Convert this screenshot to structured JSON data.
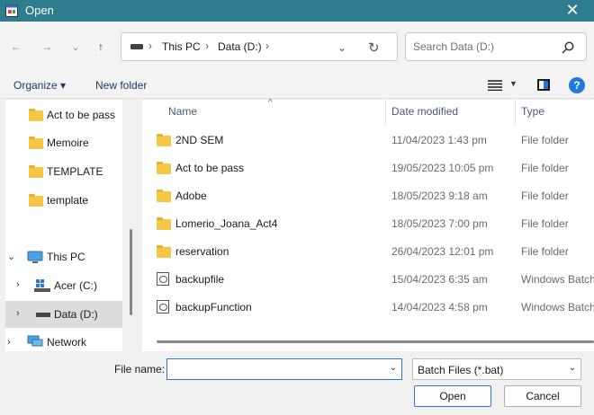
{
  "window": {
    "title": "Open",
    "close_glyph": "✕"
  },
  "nav": {
    "back_glyph": "←",
    "forward_glyph": "→",
    "recent_glyph": "⌄",
    "up_glyph": "↑",
    "breadcrumbs": [
      "This PC",
      "Data (D:)"
    ],
    "crumb_sep": "›",
    "dropdown_glyph": "⌄",
    "refresh_glyph": "↻",
    "search_placeholder": "Search Data (D:)"
  },
  "commands": {
    "organize": "Organize ▾",
    "new_folder": "New folder",
    "help": "?"
  },
  "sidebar": {
    "items": [
      {
        "label": "Act to be pass",
        "icon": "folder-icon",
        "expander": ""
      },
      {
        "label": "Memoire",
        "icon": "folder-icon",
        "expander": ""
      },
      {
        "label": "TEMPLATE",
        "icon": "folder-icon",
        "expander": ""
      },
      {
        "label": "template",
        "icon": "folder-icon",
        "expander": ""
      },
      {
        "label": "This PC",
        "icon": "computer-icon",
        "expander": "⌄"
      },
      {
        "label": "Acer (C:)",
        "icon": "drive-icon",
        "expander": "›"
      },
      {
        "label": "Data (D:)",
        "icon": "drive-icon",
        "expander": "›",
        "selected": true
      },
      {
        "label": "Network",
        "icon": "network-icon",
        "expander": "›"
      }
    ]
  },
  "filelist": {
    "columns": {
      "name": "Name",
      "date": "Date modified",
      "type": "Type"
    },
    "sort_glyph": "^",
    "rows": [
      {
        "name": "2ND SEM",
        "date": "11/04/2023 1:43 pm",
        "type": "File folder",
        "icon": "folder-icon"
      },
      {
        "name": "Act to be pass",
        "date": "19/05/2023 10:05 pm",
        "type": "File folder",
        "icon": "folder-icon"
      },
      {
        "name": "Adobe",
        "date": "18/05/2023 9:18 am",
        "type": "File folder",
        "icon": "folder-icon"
      },
      {
        "name": "Lomerio_Joana_Act4",
        "date": "18/05/2023 7:00 pm",
        "type": "File folder",
        "icon": "folder-icon"
      },
      {
        "name": "reservation",
        "date": "26/04/2023 12:01 pm",
        "type": "File folder",
        "icon": "folder-icon"
      },
      {
        "name": "backupfile",
        "date": "15/04/2023 6:35 am",
        "type": "Windows Batch",
        "icon": "batch-file-icon"
      },
      {
        "name": "backupFunction",
        "date": "14/04/2023 4:58 pm",
        "type": "Windows Batch",
        "icon": "batch-file-icon"
      }
    ]
  },
  "bottom": {
    "file_name_label": "File name:",
    "file_name_value": "",
    "filter_label": "Batch Files (*.bat)",
    "open_label": "Open",
    "cancel_label": "Cancel",
    "dropdown_glyph": "⌄"
  },
  "colors": {
    "titlebar": "#2e7d8f",
    "folder": "#f6c744",
    "accent": "#2a7ad6"
  }
}
